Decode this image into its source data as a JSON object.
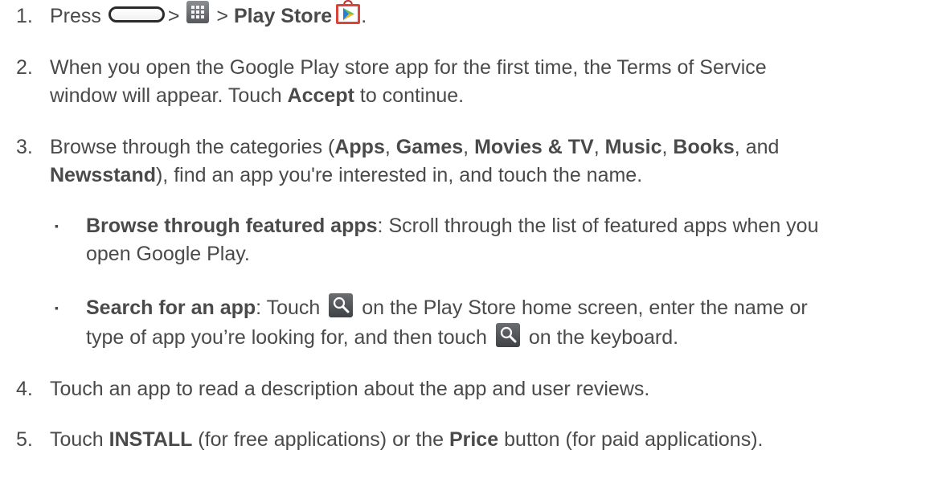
{
  "steps": {
    "s1": {
      "num": "1.",
      "press": "Press",
      "gt1": ">",
      "gt2": ">",
      "play_store": "Play Store",
      "end": "."
    },
    "s2": {
      "num": "2.",
      "line1": "When you open the Google Play store app for the first time, the Terms of Service",
      "line2_a": "window will appear. Touch ",
      "accept": "Accept",
      "line2_b": " to continue."
    },
    "s3": {
      "num": "3.",
      "a": "Browse through the categories (",
      "apps": "Apps",
      "comma1": ", ",
      "games": "Games",
      "comma2": ", ",
      "movies": "Movies & TV",
      "comma3": ", ",
      "music": "Music",
      "comma4": ", ",
      "books": "Books",
      "and": ", and",
      "newsstand": "Newsstand",
      "b": "), find an app you're interested in, and touch the name."
    },
    "b1": {
      "bold": "Browse through featured apps",
      "text1": ": Scroll through the list of featured apps when you",
      "text2": "open Google Play."
    },
    "b2": {
      "bold": "Search for an app",
      "text1a": ": Touch ",
      "text1b": " on the Play Store home screen, enter the name or",
      "text2a": "type of app you’re looking for, and then touch ",
      "text2b": " on the keyboard."
    },
    "s4": {
      "num": "4.",
      "text": "Touch an app to read a description about the app and user reviews."
    },
    "s5": {
      "num": "5.",
      "a": "Touch ",
      "install": "INSTALL",
      "b": " (for free applications) or the ",
      "price": "Price",
      "c": " button (for paid applications)."
    }
  },
  "bullet_char": "▪",
  "icons": {
    "home": "home-button-icon",
    "apps": "apps-grid-icon",
    "play": "play-store-icon",
    "search": "search-icon"
  },
  "colors": {
    "text": "#4a4a4a",
    "play_red": "#d9453c"
  }
}
